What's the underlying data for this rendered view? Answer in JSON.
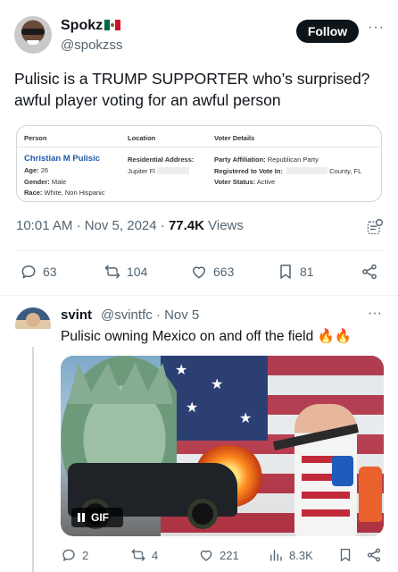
{
  "tweet": {
    "display_name": "Spokz",
    "handle": "@spokzss",
    "follow_label": "Follow",
    "more_label": "···",
    "text": "Pulisic is a TRUMP SUPPORTER who’s surprised? awful player voting for an awful person",
    "time": "10:01 AM · Nov 5, 2024 · ",
    "views_count": "77.4K",
    "views_label": " Views",
    "actions": {
      "replies": "63",
      "reposts": "104",
      "likes": "663",
      "bookmarks": "81"
    }
  },
  "record_card": {
    "headers": [
      "Person",
      "Location",
      "Voter Details"
    ],
    "person_name": "Christian M Pulisic",
    "age_label": "Age:",
    "age": "26",
    "gender_label": "Gender:",
    "gender": "Male",
    "race_label": "Race:",
    "race": "White, Non Hispanic",
    "residential_label": "Residential Address:",
    "residential_city": "Jupiter Fl",
    "party_label": "Party Affiliation:",
    "party": "Republican Party",
    "registered_label": "Registered to Vote In:",
    "registered_county": "County, FL",
    "status_label": "Voter Status:",
    "status": "Active"
  },
  "reply": {
    "display_name": "svint",
    "handle_date": "@svintfc · Nov 5",
    "more_label": "···",
    "text": "Pulisic owning Mexico on and off the field 🔥🔥",
    "gif_badge": "GIF",
    "actions": {
      "replies": "2",
      "reposts": "4",
      "likes": "221",
      "views": "8.3K"
    }
  },
  "colors": {
    "link_blue": "#1f5aa6",
    "muted": "#536471",
    "follow_bg": "#0f1419"
  }
}
